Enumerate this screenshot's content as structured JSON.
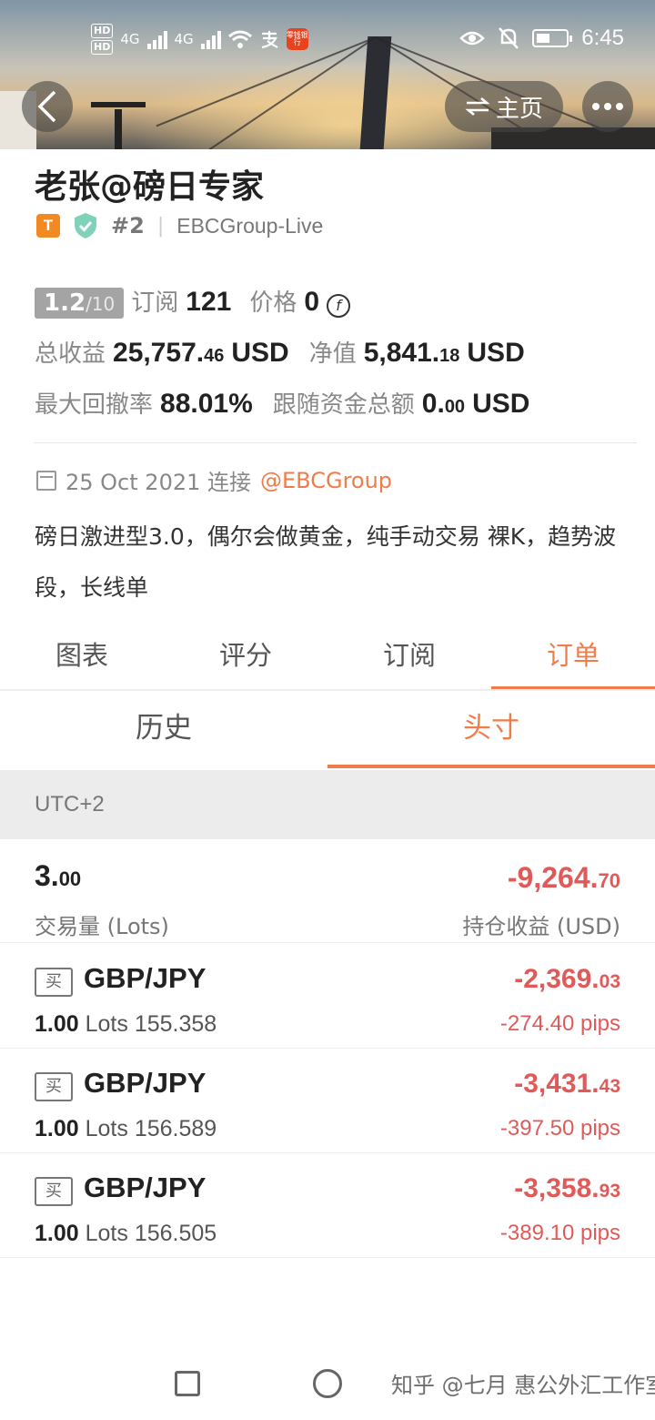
{
  "status_bar": {
    "hd1": "HD",
    "hd2": "HD",
    "net1": "4G",
    "net2": "4G",
    "app_badge": "零钱银行",
    "time": "6:45"
  },
  "header": {
    "home_label": "主页"
  },
  "profile": {
    "name": "老张@磅日专家",
    "type_badge": "T",
    "rank": "#2",
    "server": "EBCGroup-Live"
  },
  "stats": {
    "score_main": "1.2",
    "score_denom": "/10",
    "subscribe_label": "订阅",
    "subscribe_count": "121",
    "price_label": "价格",
    "price_value": "0",
    "total_profit_label": "总收益",
    "total_profit_int": "25,757.",
    "total_profit_dec": "46",
    "total_profit_unit": "USD",
    "equity_label": "净值",
    "equity_int": "5,841.",
    "equity_dec": "18",
    "equity_unit": "USD",
    "drawdown_label": "最大回撤率",
    "drawdown_value": "88.01%",
    "follow_label": "跟随资金总额",
    "follow_int": "0.",
    "follow_dec": "00",
    "follow_unit": "USD"
  },
  "linked": {
    "date_text": "25 Oct 2021 连接",
    "account": "@EBCGroup"
  },
  "description": "磅日激进型3.0，偶尔会做黄金，纯手动交易 裸K，趋势波段，长线单",
  "tabs": [
    "图表",
    "评分",
    "订阅",
    "订单"
  ],
  "subtabs": [
    "历史",
    "头寸"
  ],
  "timezone": "UTC+2",
  "summary": {
    "lots_int": "3.",
    "lots_dec": "00",
    "lots_label": "交易量 (Lots)",
    "pl_int": "-9,264.",
    "pl_dec": "70",
    "pl_label": "持仓收益 (USD)"
  },
  "orders": [
    {
      "side": "买",
      "symbol": "GBP/JPY",
      "lots": "1.00",
      "lots_unit": "Lots",
      "price": "155.358",
      "pl_int": "-2,369.",
      "pl_dec": "03",
      "pips": "-274.40 pips"
    },
    {
      "side": "买",
      "symbol": "GBP/JPY",
      "lots": "1.00",
      "lots_unit": "Lots",
      "price": "156.589",
      "pl_int": "-3,431.",
      "pl_dec": "43",
      "pips": "-397.50 pips"
    },
    {
      "side": "买",
      "symbol": "GBP/JPY",
      "lots": "1.00",
      "lots_unit": "Lots",
      "price": "156.505",
      "pl_int": "-3,358.",
      "pl_dec": "93",
      "pips": "-389.10 pips"
    }
  ],
  "watermark": "知乎 @七月 惠公外汇工作室",
  "colors": {
    "accent": "#f07c4a",
    "loss": "#e05a5a"
  }
}
